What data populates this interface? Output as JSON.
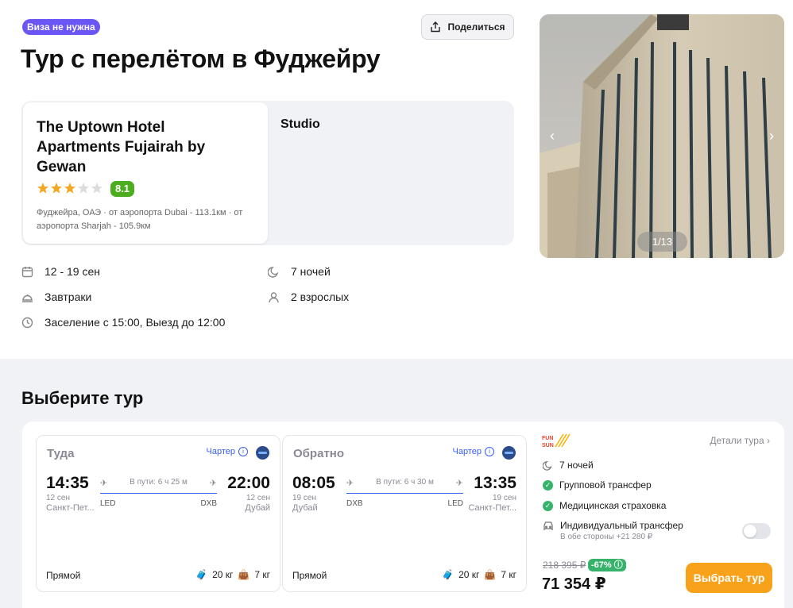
{
  "header": {
    "badge": "Виза не нужна",
    "share_label": "Поделиться",
    "title": "Тур с перелётом в Фуджейру"
  },
  "hotel": {
    "name": "The Uptown Hotel Apartments Fujairah by Gewan",
    "stars": 3,
    "stars_max": 5,
    "rating": "8.1",
    "location": "Фуджейра, ОАЭ · от аэропорта Dubai - 113.1км · от аэропорта Sharjah - 105.9км",
    "room_type": "Studio"
  },
  "facts": {
    "dates": "12 - 19 сен",
    "nights": "7 ночей",
    "meals": "Завтраки",
    "guests": "2 взрослых",
    "checkin": "Заселение с 15:00, Выезд до 12:00"
  },
  "gallery": {
    "counter": "1/13",
    "prev_icon": "chevron-left-icon",
    "next_icon": "chevron-right-icon"
  },
  "tours": {
    "heading": "Выберите тур",
    "outbound": {
      "direction": "Туда",
      "charter": "Чартер",
      "dep_time": "14:35",
      "dep_date": "12 сен",
      "dep_city": "Санкт-Пет...",
      "arr_time": "22:00",
      "arr_date": "12 сен",
      "arr_city": "Дубай",
      "duration": "В пути: 6 ч 25 м",
      "dep_code": "LED",
      "arr_code": "DXB",
      "type": "Прямой",
      "baggage": "20 кг",
      "hand_luggage": "7 кг"
    },
    "inbound": {
      "direction": "Обратно",
      "charter": "Чартер",
      "dep_time": "08:05",
      "dep_date": "19 сен",
      "dep_city": "Дубай",
      "arr_time": "13:35",
      "arr_date": "19 сен",
      "arr_city": "Санкт-Пет...",
      "duration": "В пути: 6 ч 30 м",
      "dep_code": "DXB",
      "arr_code": "LED",
      "type": "Прямой",
      "baggage": "20 кг",
      "hand_luggage": "7 кг"
    },
    "offer": {
      "details_label": "Детали тура",
      "nights": "7 ночей",
      "group_transfer": "Групповой трансфер",
      "insurance": "Медицинская страховка",
      "individual_transfer": "Индивидуальный трансфер",
      "individual_transfer_sub": "В обе стороны +21 280 ₽",
      "individual_transfer_enabled": false,
      "old_price": "218 395 ₽",
      "discount": "-67%",
      "price": "71 354 ₽",
      "button": "Выбрать тур",
      "accent_color": "#f8a21b",
      "check_color": "#36b26b"
    }
  }
}
